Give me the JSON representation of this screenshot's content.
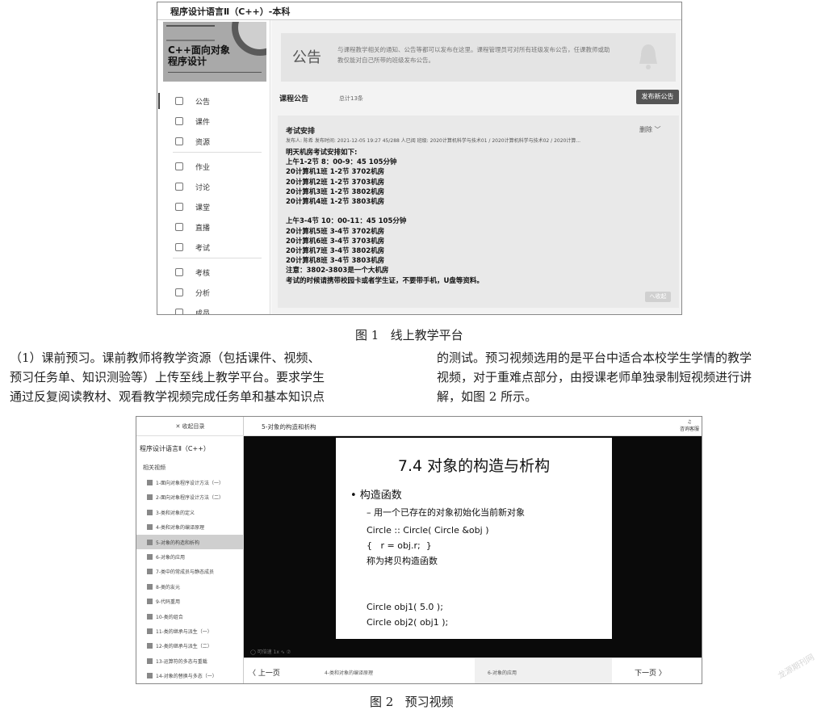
{
  "figure1": {
    "course_title": "程序设计语言Ⅱ（C++）-本科",
    "cover_title": "C++面向对象程序设计",
    "nav": [
      {
        "label": "公告",
        "icon": "bell-icon",
        "active": true
      },
      {
        "label": "课件",
        "icon": "document-icon"
      },
      {
        "label": "资源",
        "icon": "folder-icon"
      },
      {
        "label": "作业",
        "icon": "clipboard-icon"
      },
      {
        "label": "讨论",
        "icon": "chat-icon"
      },
      {
        "label": "课堂",
        "icon": "person-icon"
      },
      {
        "label": "直播",
        "icon": "video-icon"
      },
      {
        "label": "考试",
        "icon": "exam-icon"
      },
      {
        "label": "考核",
        "icon": "checklist-icon"
      },
      {
        "label": "分析",
        "icon": "chart-icon"
      },
      {
        "label": "成员",
        "icon": "members-icon"
      }
    ],
    "banner": {
      "title": "公告",
      "description": "与课程教学相关的通知、公告等都可以发布在这里。课程管理员可对所有班级发布公告，任课教师或助教仅能对自己所带的班级发布公告。"
    },
    "announcements_header": "课程公告",
    "announcements_count": "总计13条",
    "new_button": "发布新公告",
    "card": {
      "title": "考试安排",
      "meta": "发布人: 陈希    发布时间: 2021-12-05 19:27    45/288 人已阅    班级: 2020计算机科学与技术01 / 2020计算机科学与技术02 / 2020计算...",
      "delete": "删除 ﹀",
      "body_lines": [
        "明天机房考试安排如下:",
        "上午1-2节 8：00-9：45  105分钟",
        "20计算机1班 1-2节 3702机房",
        "20计算机2班 1-2节 3703机房",
        "20计算机3班 1-2节 3802机房",
        "20计算机4班 1-2节 3803机房",
        "",
        "上午3-4节 10：00-11：45 105分钟",
        "20计算机5班 3-4节 3702机房",
        "20计算机6班 3-4节 3703机房",
        "20计算机7班 3-4节 3802机房",
        "20计算机8班 3-4节 3803机房",
        "注意：3802-3803是一个大机房",
        "考试的时候请携带校园卡或者学生证，不要带手机，U盘等资料。"
      ],
      "collapse": "へ收起"
    }
  },
  "caption1": "图 1   线上教学平台",
  "paragraph": {
    "left_lines": [
      "（1）课前预习。课前教师将教学资源（包括课件、视频、",
      "预习任务单、知识测验等）上传至线上教学平台。要求学生",
      "通过反复阅读教材、观看教学视频完成任务单和基本知识点"
    ],
    "right_lines": [
      "的测试。预习视频选用的是平台中适合本校学生学情的教学",
      "视频，对于重难点部分，由授课老师单独录制短视频进行讲",
      "解，如图 2 所示。"
    ]
  },
  "figure2": {
    "collapse_dir": "✕ 收起目录",
    "video_title": "5-对象的构造和析构",
    "help": "咨询客服",
    "course": "程序设计语言Ⅱ（C++）",
    "related": "相关视频",
    "list": [
      "1-面向对象程序设计方法（一）",
      "2-面向对象程序设计方法（二）",
      "3-类和对象的定义",
      "4-类和对象的编译原理",
      "5-对象的构造和析构",
      "6-对象的应用",
      "7-类中的常成员与静态成员",
      "8-类的友元",
      "9-代码重用",
      "10-类的组合",
      "11-类的继承与派生（一）",
      "12-类的继承与派生（二）",
      "13-运算符的多态与重载",
      "14-对象的替换与多态（一）"
    ],
    "active_index": 4,
    "slide": {
      "title": "7.4 对象的构造与析构",
      "bullet": "• 构造函数",
      "sub": "– 用一个已存在的对象初始化当前新对象",
      "code": "Circle :: Circle( Circle &obj )\n{   r = obj.r;  }\n称为拷贝构造函数\n\n\nCircle obj1( 5.0 );\nCircle obj2( obj1 );"
    },
    "controls": "◯ 可倍速 1x ∿ ⑦",
    "prev": "〈  上一页",
    "prev_title": "4-类和对象的编译原理",
    "next_title": "6-对象的应用",
    "next": "下一页  〉"
  },
  "caption2": "图 2   预习视频",
  "watermark": "龙源期刊网"
}
